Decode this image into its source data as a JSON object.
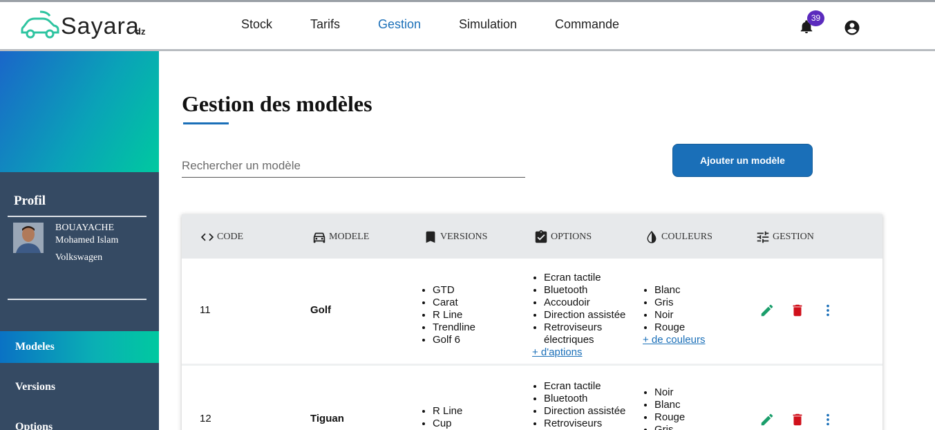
{
  "header": {
    "logo_text": "Sayara",
    "logo_suffix": "dz",
    "nav": [
      {
        "label": "Stock",
        "active": false
      },
      {
        "label": "Tarifs",
        "active": false
      },
      {
        "label": "Gestion",
        "active": true
      },
      {
        "label": "Simulation",
        "active": false
      },
      {
        "label": "Commande",
        "active": false
      }
    ],
    "notification_count": "39",
    "icons": [
      "car-logo-icon",
      "bell-icon",
      "account-circle-icon"
    ]
  },
  "sidebar": {
    "profile_title": "Profil",
    "user_last_name": "BOUAYACHE",
    "user_first_name": "Mohamed Islam",
    "brand": "Volkswagen",
    "items": [
      {
        "label": "Modeles",
        "active": true
      },
      {
        "label": "Versions",
        "active": false
      },
      {
        "label": "Options",
        "active": false
      }
    ]
  },
  "main": {
    "title": "Gestion des modèles",
    "search_placeholder": "Rechercher un modèle",
    "add_button": "Ajouter un modèle",
    "columns": [
      {
        "label": "CODE",
        "icon": "code-icon"
      },
      {
        "label": "MODELE",
        "icon": "car-icon"
      },
      {
        "label": "VERSIONS",
        "icon": "bookmark-icon"
      },
      {
        "label": "OPTIONS",
        "icon": "clipboard-check-icon"
      },
      {
        "label": "COULEURS",
        "icon": "drop-icon"
      },
      {
        "label": "GESTION",
        "icon": "sliders-icon"
      }
    ],
    "rows": [
      {
        "code": "11",
        "model": "Golf",
        "versions": [
          "GTD",
          "Carat",
          "R Line",
          "Trendline",
          "Golf 6"
        ],
        "options": [
          "Ecran tactile",
          "Bluetooth",
          "Accoudoir",
          "Direction assistée",
          "Retroviseurs électriques"
        ],
        "more_options": "+ d'aptions",
        "colors": [
          "Blanc",
          "Gris",
          "Noir",
          "Rouge"
        ],
        "more_colors": "+ de couleurs"
      },
      {
        "code": "12",
        "model": "Tiguan",
        "versions": [
          "R Line",
          "Cup"
        ],
        "options": [
          "Ecran tactile",
          "Bluetooth",
          "Direction assistée",
          "Retroviseurs"
        ],
        "colors": [
          "Noir",
          "Blanc",
          "Rouge",
          "Gris"
        ]
      }
    ],
    "row_actions": [
      "edit-icon",
      "delete-icon",
      "more-vert-icon"
    ],
    "action_colors": {
      "edit": "#1a9e6b",
      "delete": "#d0101b",
      "more": "#1a6fb8"
    }
  }
}
